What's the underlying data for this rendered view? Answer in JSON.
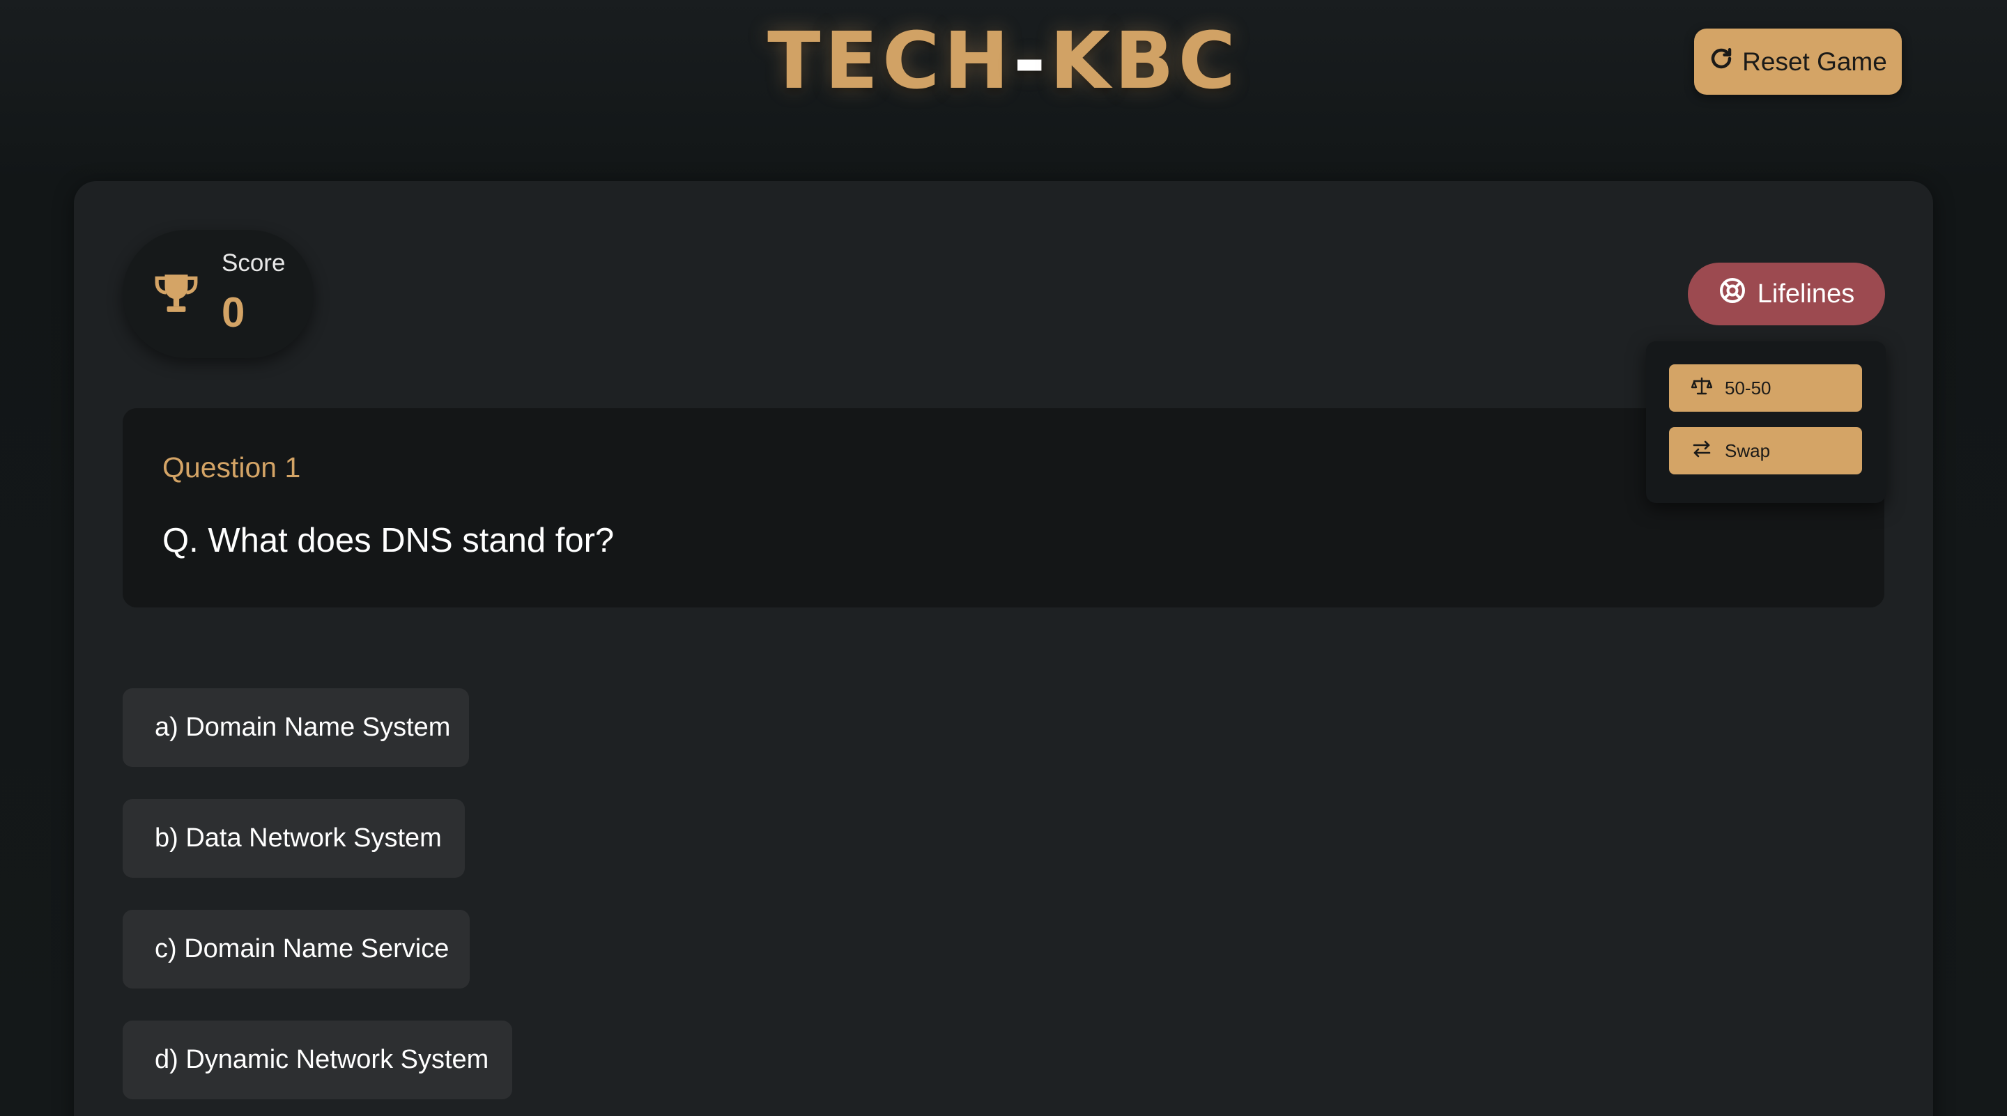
{
  "header": {
    "title_part_a": "TECH",
    "title_part_b": "-",
    "title_part_c": "KBC",
    "reset_label": "Reset Game",
    "reset_icon": "rotate-right-icon"
  },
  "score": {
    "label": "Score",
    "value": "0",
    "icon": "trophy-icon"
  },
  "lifelines": {
    "label": "Lifelines",
    "icon": "life-ring-icon",
    "options": [
      {
        "label": "50-50",
        "icon": "scale-balanced-icon"
      },
      {
        "label": "Swap",
        "icon": "swap-arrows-icon"
      }
    ]
  },
  "question": {
    "number_label": "Question 1",
    "text": "Q. What does DNS stand for?"
  },
  "answers": [
    "a) Domain Name System",
    "b) Data Network System",
    "c) Domain Name Service",
    "d) Dynamic Network System"
  ],
  "colors": {
    "accent": "#d4a466",
    "lifelines_button": "#9c4a50",
    "background": "#141819",
    "card": "#1e2123",
    "answer_bg": "#2d2f31"
  }
}
